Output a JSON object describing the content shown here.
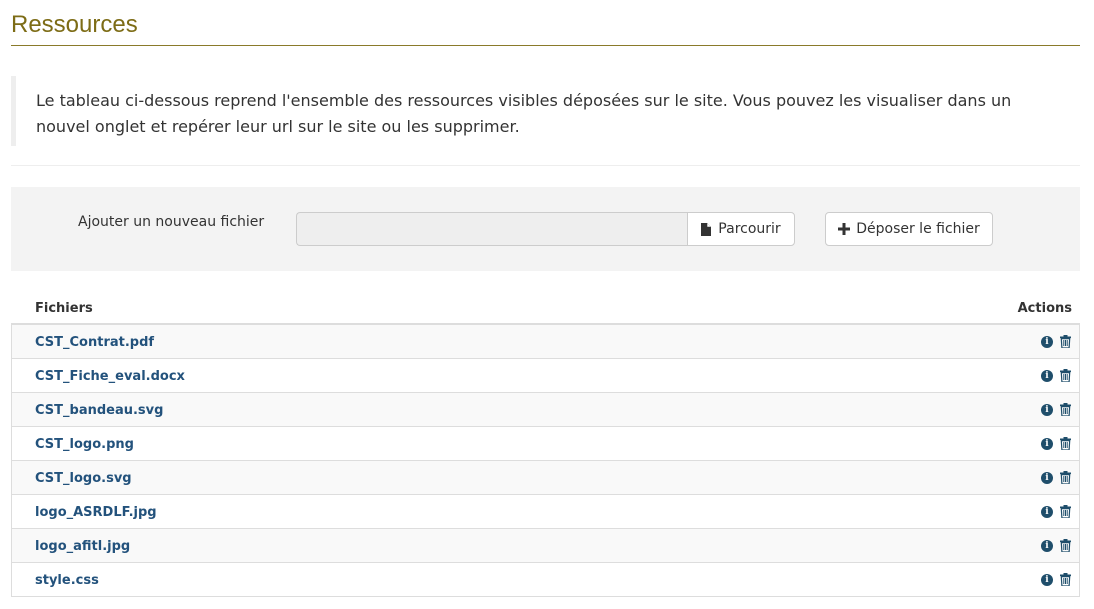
{
  "header": {
    "title": "Ressources"
  },
  "intro": {
    "text": "Le tableau ci-dessous reprend l'ensemble des ressources visibles déposées sur le site. Vous pouvez les visualiser dans un nouvel onglet et repérer leur url sur le site ou les supprimer."
  },
  "upload": {
    "label": "Ajouter un nouveau fichier",
    "file_value": "",
    "browse_label": "Parcourir",
    "browse_icon": "file-icon",
    "deposit_label": "Déposer le fichier",
    "deposit_icon": "plus-icon"
  },
  "table": {
    "headers": {
      "files": "Fichiers",
      "actions": "Actions"
    },
    "rows": [
      {
        "name": "CST_Contrat.pdf"
      },
      {
        "name": "CST_Fiche_eval.docx"
      },
      {
        "name": "CST_bandeau.svg"
      },
      {
        "name": "CST_logo.png"
      },
      {
        "name": "CST_logo.svg"
      },
      {
        "name": "logo_ASRDLF.jpg"
      },
      {
        "name": "logo_afitl.jpg"
      },
      {
        "name": "style.css"
      }
    ],
    "row_actions": [
      "info-icon",
      "trash-icon"
    ]
  },
  "colors": {
    "title": "#7d6c16",
    "link": "#23527c",
    "panel_bg": "#f3f3f3"
  }
}
